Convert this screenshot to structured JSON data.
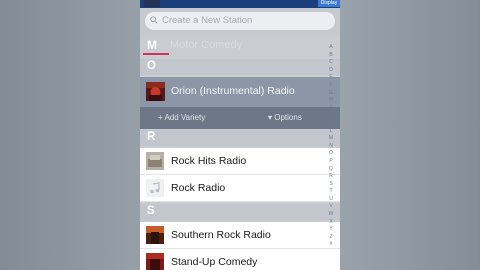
{
  "search": {
    "placeholder": "Create a New Station"
  },
  "topbar": {
    "right_button": "Display"
  },
  "sections": {
    "m": {
      "letter": "M",
      "faded_text": "Motor Comedy"
    },
    "o": "O",
    "r": "R",
    "s": "S"
  },
  "selected_station": {
    "title": "Orion (Instrumental) Radio"
  },
  "actions": {
    "add_variety": "Add Variety",
    "options": "Options"
  },
  "stations_r": [
    {
      "title": "Rock Hits Radio",
      "icon": "rock-hits-thumbnail"
    },
    {
      "title": "Rock Radio",
      "icon": "music-note-icon"
    }
  ],
  "stations_s": [
    {
      "title": "Southern Rock Radio",
      "icon": "southern-rock-thumbnail"
    },
    {
      "title": "Stand-Up Comedy",
      "icon": "comedy-thumbnail"
    }
  ],
  "index_letters": [
    "A",
    "B",
    "C",
    "D",
    "E",
    "F",
    "G",
    "H",
    "I",
    "J",
    "K",
    "L",
    "M",
    "N",
    "O",
    "P",
    "Q",
    "R",
    "S",
    "T",
    "U",
    "V",
    "W",
    "X",
    "Y",
    "Z",
    "#"
  ],
  "colors": {
    "accent_bar": "#d3305c",
    "selected_row": "#8b97a6",
    "action_bar": "#6c7888"
  }
}
